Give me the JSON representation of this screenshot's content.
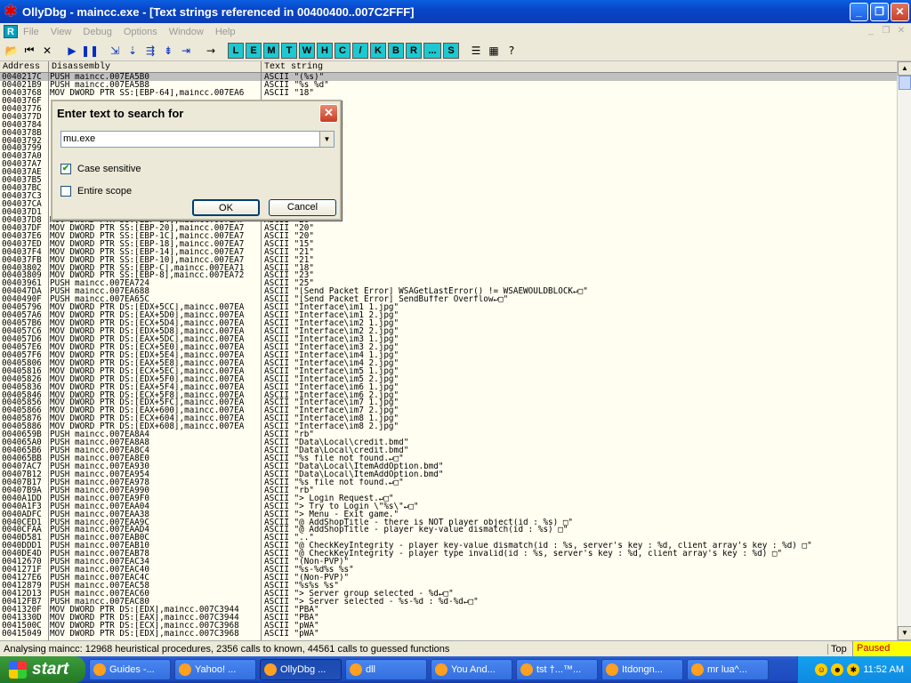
{
  "window": {
    "title": "OllyDbg - maincc.exe - [Text strings referenced in 00400400..007C2FFF]"
  },
  "menu": [
    "File",
    "View",
    "Debug",
    "Options",
    "Window",
    "Help"
  ],
  "toolbar": {
    "letters": [
      "L",
      "E",
      "M",
      "T",
      "W",
      "H",
      "C",
      "/",
      "K",
      "B",
      "R",
      "...",
      "S"
    ]
  },
  "columns": {
    "address": "Address",
    "disassembly": "Disassembly",
    "text": "Text string"
  },
  "rows": [
    [
      "0040217C",
      "PUSH maincc.007EA5B0",
      "ASCII \"(%s)\""
    ],
    [
      "004021B9",
      "PUSH maincc.007EA5B8",
      "ASCII \"%s %d\""
    ],
    [
      "00403768",
      "MOV DWORD PTR SS:[EBP-64],maincc.007EA6",
      "ASCII \"18\""
    ],
    [
      "0040376F",
      "",
      ""
    ],
    [
      "00403776",
      "",
      ""
    ],
    [
      "0040377D",
      "",
      ""
    ],
    [
      "00403784",
      "",
      ""
    ],
    [
      "0040378B",
      "",
      ""
    ],
    [
      "00403792",
      "",
      ""
    ],
    [
      "00403799",
      "",
      ""
    ],
    [
      "004037A0",
      "",
      ""
    ],
    [
      "004037A7",
      "",
      ""
    ],
    [
      "004037AE",
      "",
      ""
    ],
    [
      "004037B5",
      "",
      ""
    ],
    [
      "004037BC",
      "",
      ""
    ],
    [
      "004037C3",
      "",
      ""
    ],
    [
      "004037CA",
      "",
      ""
    ],
    [
      "004037D1",
      "",
      ""
    ],
    [
      "004037D8",
      "MOV DWORD PTR SS:[EBP-24],maincc.007EA7",
      "ASCII \"20\""
    ],
    [
      "004037DF",
      "MOV DWORD PTR SS:[EBP-20],maincc.007EA7",
      "ASCII \"20\""
    ],
    [
      "004037E6",
      "MOV DWORD PTR SS:[EBP-1C],maincc.007EA7",
      "ASCII \"20\""
    ],
    [
      "004037ED",
      "MOV DWORD PTR SS:[EBP-18],maincc.007EA7",
      "ASCII \"15\""
    ],
    [
      "004037F4",
      "MOV DWORD PTR SS:[EBP-14],maincc.007EA7",
      "ASCII \"21\""
    ],
    [
      "004037FB",
      "MOV DWORD PTR SS:[EBP-10],maincc.007EA7",
      "ASCII \"21\""
    ],
    [
      "00403802",
      "MOV DWORD PTR SS:[EBP-C],maincc.007EA71",
      "ASCII \"18\""
    ],
    [
      "00403809",
      "MOV DWORD PTR SS:[EBP-8],maincc.007EA72",
      "ASCII \"23\""
    ],
    [
      "00403961",
      "PUSH maincc.007EA724",
      "ASCII \"25\""
    ],
    [
      "004047DA",
      "PUSH maincc.007EA688",
      "ASCII \"[Send Packet Error] WSAGetLastError() != WSAEWOULDBLOCK↵□\""
    ],
    [
      "0040490F",
      "PUSH maincc.007EA65C",
      "ASCII \"[Send Packet Error] SendBuffer Overflow↵□\""
    ],
    [
      "00405796",
      "MOV DWORD PTR DS:[EDX+5CC],maincc.007EA",
      "ASCII \"Interface\\im1_1.jpg\""
    ],
    [
      "004057A6",
      "MOV DWORD PTR DS:[EAX+5D0],maincc.007EA",
      "ASCII \"Interface\\im1_2.jpg\""
    ],
    [
      "004057B6",
      "MOV DWORD PTR DS:[ECX+5D4],maincc.007EA",
      "ASCII \"Interface\\im2_1.jpg\""
    ],
    [
      "004057C6",
      "MOV DWORD PTR DS:[EDX+5D8],maincc.007EA",
      "ASCII \"Interface\\im2_2.jpg\""
    ],
    [
      "004057D6",
      "MOV DWORD PTR DS:[EAX+5DC],maincc.007EA",
      "ASCII \"Interface\\im3_1.jpg\""
    ],
    [
      "004057E6",
      "MOV DWORD PTR DS:[ECX+5E0],maincc.007EA",
      "ASCII \"Interface\\im3_2.jpg\""
    ],
    [
      "004057F6",
      "MOV DWORD PTR DS:[EDX+5E4],maincc.007EA",
      "ASCII \"Interface\\im4_1.jpg\""
    ],
    [
      "00405806",
      "MOV DWORD PTR DS:[EAX+5E8],maincc.007EA",
      "ASCII \"Interface\\im4_2.jpg\""
    ],
    [
      "00405816",
      "MOV DWORD PTR DS:[ECX+5EC],maincc.007EA",
      "ASCII \"Interface\\im5_1.jpg\""
    ],
    [
      "00405826",
      "MOV DWORD PTR DS:[EDX+5F0],maincc.007EA",
      "ASCII \"Interface\\im5_2.jpg\""
    ],
    [
      "00405836",
      "MOV DWORD PTR DS:[EAX+5F4],maincc.007EA",
      "ASCII \"Interface\\im6_1.jpg\""
    ],
    [
      "00405846",
      "MOV DWORD PTR DS:[ECX+5F8],maincc.007EA",
      "ASCII \"Interface\\im6_2.jpg\""
    ],
    [
      "00405856",
      "MOV DWORD PTR DS:[EDX+5FC],maincc.007EA",
      "ASCII \"Interface\\im7_1.jpg\""
    ],
    [
      "00405866",
      "MOV DWORD PTR DS:[EAX+600],maincc.007EA",
      "ASCII \"Interface\\im7_2.jpg\""
    ],
    [
      "00405876",
      "MOV DWORD PTR DS:[ECX+604],maincc.007EA",
      "ASCII \"Interface\\im8_1.jpg\""
    ],
    [
      "00405886",
      "MOV DWORD PTR DS:[EDX+608],maincc.007EA",
      "ASCII \"Interface\\im8_2.jpg\""
    ],
    [
      "0040659B",
      "PUSH maincc.007EA8A4",
      "ASCII \"rb\""
    ],
    [
      "004065A0",
      "PUSH maincc.007EA8A8",
      "ASCII \"Data\\Local\\credit.bmd\""
    ],
    [
      "004065B6",
      "PUSH maincc.007EA8C4",
      "ASCII \"Data\\Local\\credit.bmd\""
    ],
    [
      "004065BB",
      "PUSH maincc.007EA8E0",
      "ASCII \"%s file not found.↵□\""
    ],
    [
      "00407AC7",
      "PUSH maincc.007EA930",
      "ASCII \"Data\\Local\\ItemAddOption.bmd\""
    ],
    [
      "00407B12",
      "PUSH maincc.007EA954",
      "ASCII \"Data\\Local\\ItemAddOption.bmd\""
    ],
    [
      "00407B17",
      "PUSH maincc.007EA978",
      "ASCII \"%s file not found.↵□\""
    ],
    [
      "00407B9A",
      "PUSH maincc.007EA990",
      "ASCII \"rb\""
    ],
    [
      "0040A1DD",
      "PUSH maincc.007EA9F0",
      "ASCII \"> Login Request.↵□\""
    ],
    [
      "0040A1F3",
      "PUSH maincc.007EAA04",
      "ASCII \"> Try to Login \\\"%s\\\"↵□\""
    ],
    [
      "0040ADFC",
      "PUSH maincc.007EAA38",
      "ASCII \"> Menu - Exit game.\""
    ],
    [
      "0040CED1",
      "PUSH maincc.007EAA9C",
      "ASCII \"@ AddShopTitle - there is NOT player object(id : %s) □\""
    ],
    [
      "0040CFAA",
      "PUSH maincc.007EAAD4",
      "ASCII \"@ AddShopTitle - player key-value dismatch(id : %s) □\""
    ],
    [
      "0040D581",
      "PUSH maincc.007EAB0C",
      "ASCII \"..\""
    ],
    [
      "0040DDD1",
      "PUSH maincc.007EAB10",
      "ASCII \"@ CheckKeyIntegrity - player key-value dismatch(id : %s, server's key : %d, client array's key : %d) □\""
    ],
    [
      "0040DE4D",
      "PUSH maincc.007EAB78",
      "ASCII \"@ CheckKeyIntegrity - player type invalid(id : %s, server's key : %d, client array's key : %d) □\""
    ],
    [
      "00412670",
      "PUSH maincc.007EAC34",
      "ASCII \"(Non-PVP)\""
    ],
    [
      "0041271F",
      "PUSH maincc.007EAC40",
      "ASCII \"%s-%d%s %s\""
    ],
    [
      "004127E6",
      "PUSH maincc.007EAC4C",
      "ASCII \"(Non-PVP)\""
    ],
    [
      "00412879",
      "PUSH maincc.007EAC58",
      "ASCII \"%s%s %s\""
    ],
    [
      "00412D13",
      "PUSH maincc.007EAC60",
      "ASCII \"> Server group selected - %d↵□\""
    ],
    [
      "00412FB7",
      "PUSH maincc.007EAC80",
      "ASCII \"> Server selected - %s-%d : %d-%d↵□\""
    ],
    [
      "0041320F",
      "MOV DWORD PTR DS:[EDX],maincc.007C3944",
      "ASCII \"PBA\""
    ],
    [
      "0041330D",
      "MOV DWORD PTR DS:[EAX],maincc.007C3944",
      "ASCII \"PBA\""
    ],
    [
      "0041500C",
      "MOV DWORD PTR DS:[ECX],maincc.007C3968",
      "ASCII \"pWA\""
    ],
    [
      "00415049",
      "MOV DWORD PTR DS:[EDX],maincc.007C3968",
      "ASCII \"pWA\""
    ]
  ],
  "status": {
    "message": "Analysing maincc: 12968 heuristical procedures, 2356 calls to known, 44561 calls to guessed functions",
    "top": "Top",
    "state": "Paused"
  },
  "dialog": {
    "title": "Enter text to search for",
    "value": "mu.exe",
    "case_sensitive": "Case sensitive",
    "entire_scope": "Entire scope",
    "ok": "OK",
    "cancel": "Cancel"
  },
  "taskbar": {
    "start": "start",
    "tasks": [
      "Guides -...",
      "Yahoo! ...",
      "OllyDbg ...",
      "dll",
      "You And...",
      "tst †...™...",
      "Itdongn...",
      "mr lua^..."
    ],
    "clock": "11:52 AM"
  }
}
